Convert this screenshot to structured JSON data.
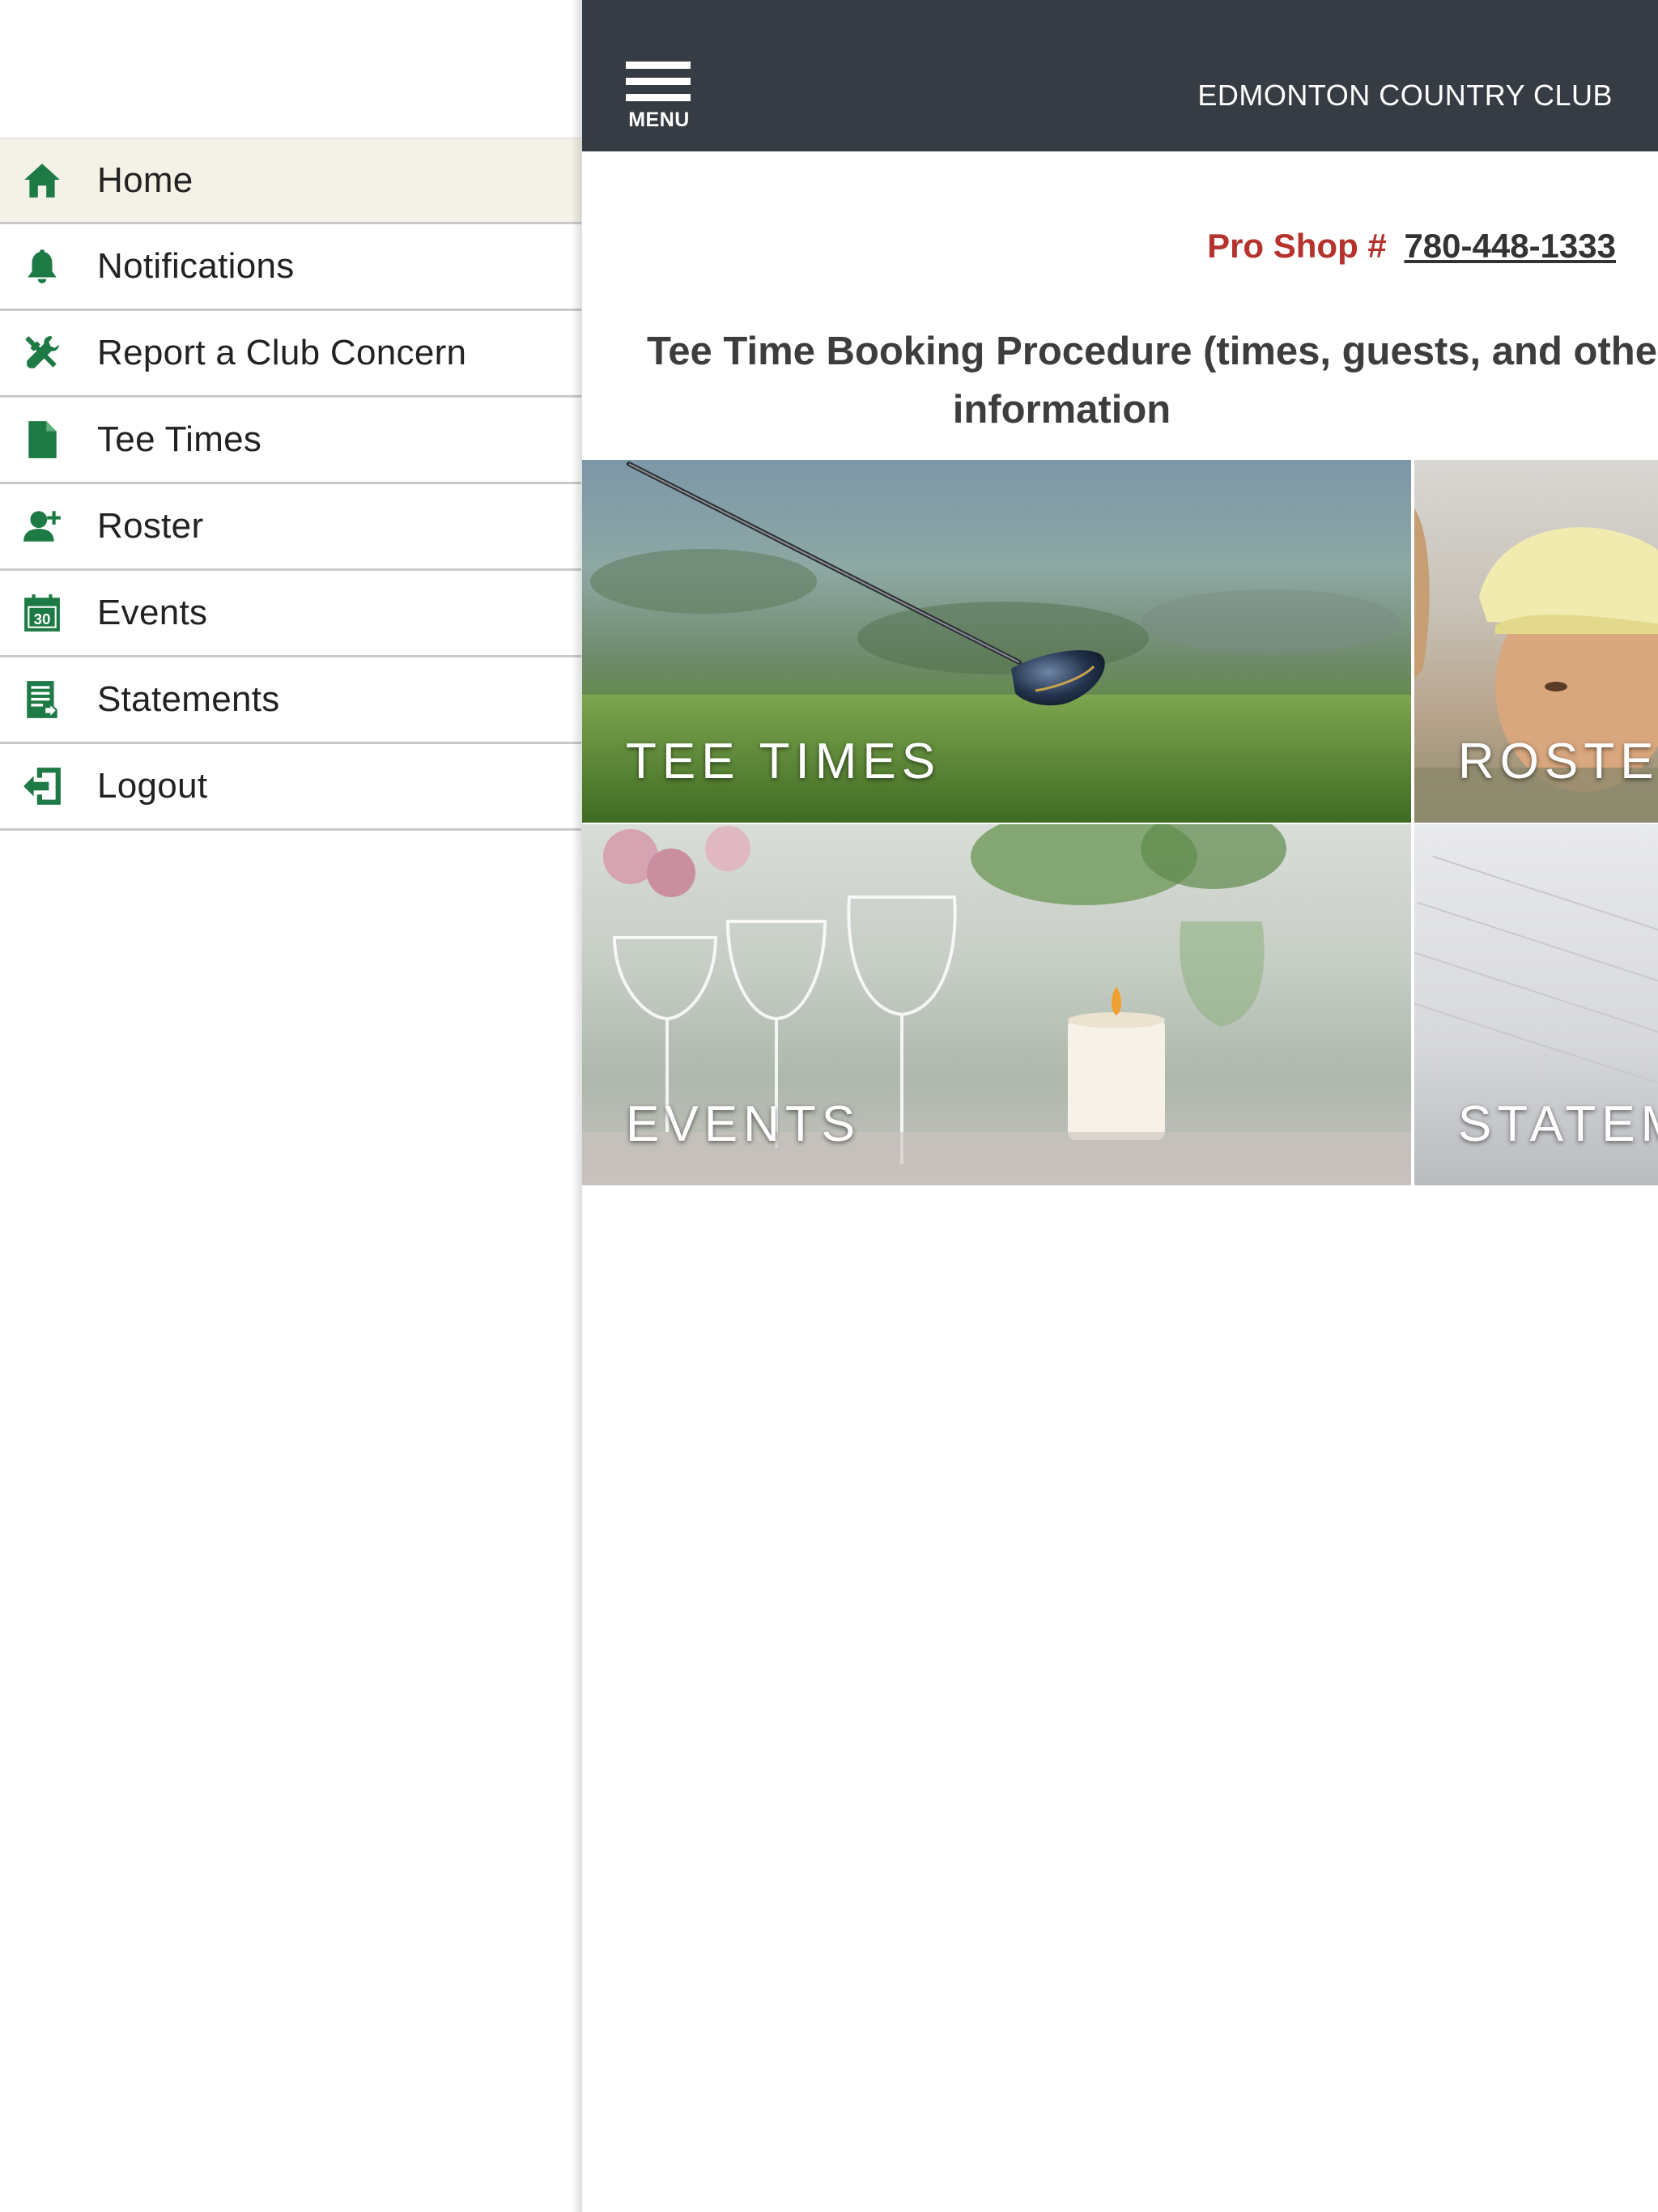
{
  "sidebar": {
    "items": [
      {
        "label": "Home",
        "icon": "home-icon",
        "active": true
      },
      {
        "label": "Notifications",
        "icon": "bell-icon"
      },
      {
        "label": "Report a Club Concern",
        "icon": "tools-icon"
      },
      {
        "label": "Tee Times",
        "icon": "document-icon"
      },
      {
        "label": "Roster",
        "icon": "person-add-icon"
      },
      {
        "label": "Events",
        "icon": "calendar-icon"
      },
      {
        "label": "Statements",
        "icon": "statement-icon"
      },
      {
        "label": "Logout",
        "icon": "logout-icon"
      }
    ],
    "calendar_day": "30"
  },
  "header": {
    "menu_label": "MENU",
    "title": "EDMONTON COUNTRY CLUB"
  },
  "main": {
    "proshop_label": "Pro Shop #",
    "proshop_phone": "780-448-1333",
    "procedure_line1": "Tee Time Booking Procedure (times, guests, and other details) and",
    "procedure_line2": "information",
    "tiles": [
      {
        "label": "TEE TIMES"
      },
      {
        "label": "ROSTER"
      },
      {
        "label": "EVENTS"
      },
      {
        "label": "STATEMENTS"
      }
    ]
  },
  "colors": {
    "brand_green": "#1d7a45",
    "header_bg": "#363c43",
    "proshop_red": "#b5322d",
    "active_row_bg": "#f4f1e7"
  }
}
